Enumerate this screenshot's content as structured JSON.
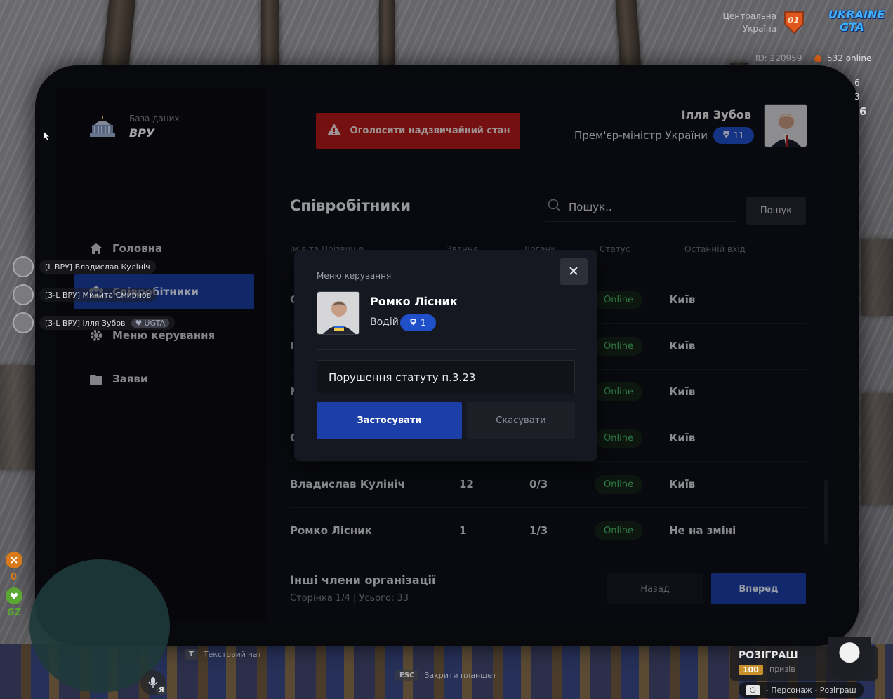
{
  "hud": {
    "region_line1": "Центральна",
    "region_line2": "Україна",
    "region_code": "01",
    "logo_line1": "UKRAINE",
    "logo_line2": "GTA",
    "player_id": "ID: 220959",
    "online": "532 online",
    "side_num1": "6",
    "side_num2": "3",
    "side_num3": "6",
    "stat_zero": "0",
    "stat_gz": "GZ",
    "chat_key": "T",
    "chat_label": "Текстовий чат",
    "esc_key": "ESC",
    "esc_label": "Закрити планшет",
    "mic_key": "Я",
    "prize_title": "РОЗІГРАШ",
    "prize_count": "100",
    "prize_sub": "призів",
    "prize_hint": "- Персонаж - Розіграш"
  },
  "nametags": [
    {
      "text": "[L ВРУ] Владислав Кулініч"
    },
    {
      "text": "[3-L ВРУ] Микита Смирнов"
    },
    {
      "text": "[3-L ВРУ] Ілля Зубов",
      "badge": "UGTA"
    }
  ],
  "sidebar": {
    "brand_sub": "База даних",
    "brand_title": "ВРУ",
    "items": [
      {
        "label": "Головна",
        "icon": "home-icon"
      },
      {
        "label": "Співробітники",
        "icon": "users-icon",
        "active": true
      },
      {
        "label": "Меню керування",
        "icon": "gear-icon"
      },
      {
        "label": "Заяви",
        "icon": "folder-icon"
      }
    ]
  },
  "header": {
    "alert_label": "Оголосити надзвичайний стан",
    "user_name": "Ілля Зубов",
    "user_role": "Прем'єр-міністр України",
    "user_rank": "11"
  },
  "employees": {
    "title": "Співробітники",
    "search_placeholder": "Пошук..",
    "search_button": "Пошук",
    "columns": [
      "Ім'я та Прізвище",
      "Звання",
      "Догани",
      "Статус",
      "Останній вхід"
    ],
    "rows": [
      {
        "name": "С",
        "rank": "",
        "warns": "",
        "status": "Online",
        "last": "Київ"
      },
      {
        "name": "І",
        "rank": "",
        "warns": "",
        "status": "Online",
        "last": "Київ"
      },
      {
        "name": "М",
        "rank": "",
        "warns": "",
        "status": "Online",
        "last": "Київ"
      },
      {
        "name": "С",
        "rank": "",
        "warns": "",
        "status": "Online",
        "last": "Київ"
      },
      {
        "name": "Владислав Кулініч",
        "rank": "12",
        "warns": "0/3",
        "status": "Online",
        "last": "Київ"
      },
      {
        "name": "Ромко Лісник",
        "rank": "1",
        "warns": "1/3",
        "status": "Online",
        "last": "Не на зміні"
      }
    ],
    "other_title": "Інші члени організації",
    "page_info": "Сторінка 1/4 | Усього: 33",
    "prev_label": "Назад",
    "next_label": "Вперед"
  },
  "modal": {
    "title": "Меню керування",
    "name": "Ромко Лісник",
    "role": "Водій",
    "rank": "1",
    "reason_value": "Порушення статуту п.3.23",
    "apply_label": "Застосувати",
    "cancel_label": "Скасувати"
  },
  "colors": {
    "accent": "#1b3fa7",
    "alert": "#b31a1a",
    "online": "#4bc06a"
  }
}
